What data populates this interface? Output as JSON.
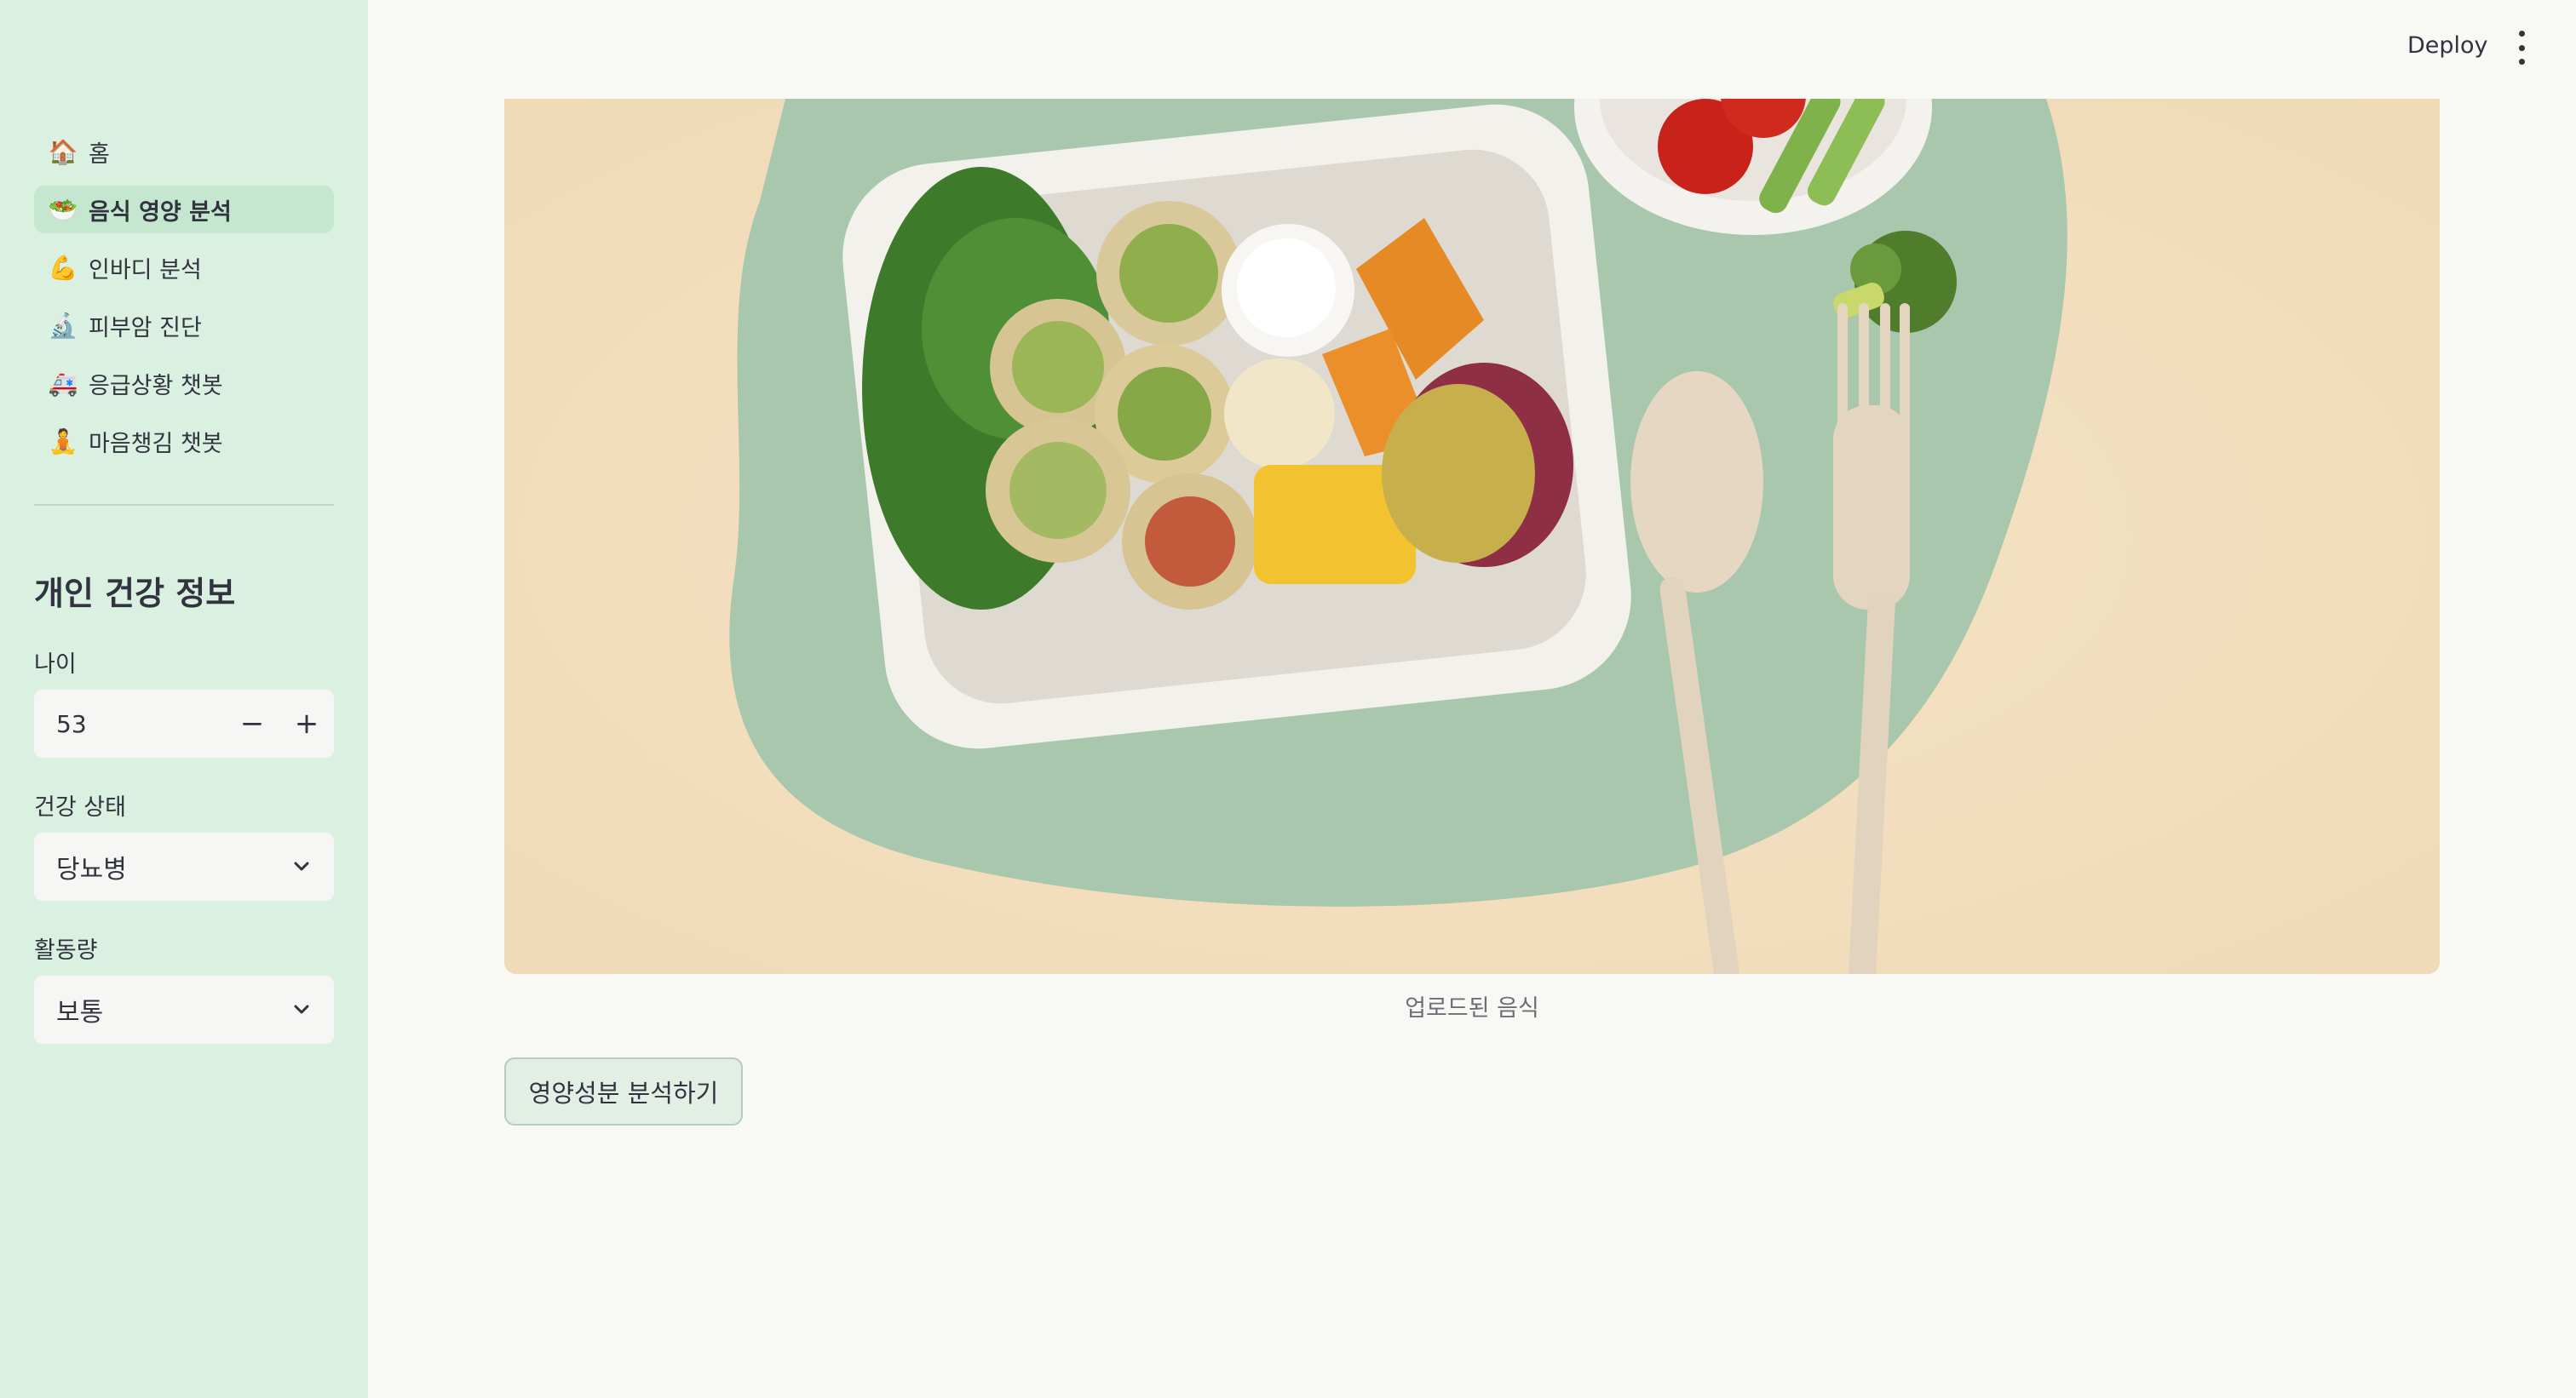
{
  "sidebar": {
    "nav": [
      {
        "icon": "🏠",
        "icon_name": "house-icon",
        "label": "홈"
      },
      {
        "icon": "🥗",
        "icon_name": "salad-icon",
        "label": "음식 영양 분석",
        "active": true
      },
      {
        "icon": "💪",
        "icon_name": "flexed-bicep-icon",
        "label": "인바디 분석"
      },
      {
        "icon": "🔬",
        "icon_name": "microscope-icon",
        "label": "피부암 진단"
      },
      {
        "icon": "🚑",
        "icon_name": "ambulance-icon",
        "label": "응급상황 챗봇"
      },
      {
        "icon": "🧘",
        "icon_name": "meditation-icon",
        "label": "마음챙김 챗봇"
      }
    ],
    "section_title": "개인 건강 정보",
    "age": {
      "label": "나이",
      "value": "53",
      "minus": "−",
      "plus": "+"
    },
    "health": {
      "label": "건강 상태",
      "value": "당뇨병"
    },
    "activity": {
      "label": "활동량",
      "value": "보통"
    }
  },
  "header": {
    "deploy_label": "Deploy",
    "menu_icon": "more-vertical-icon"
  },
  "main": {
    "caption": "업로드된 음식",
    "analyze_label": "영양성분 분석하기"
  },
  "colors": {
    "sidebar_bg": "#daf1e1",
    "active_nav_bg": "#c5e7d0",
    "page_bg": "#f8f8f5",
    "button_bg": "#e3efe5"
  }
}
